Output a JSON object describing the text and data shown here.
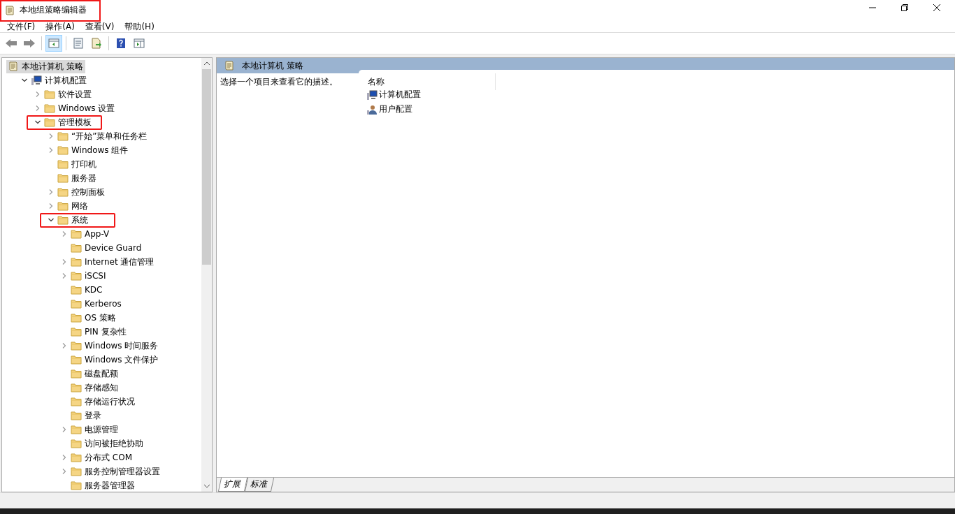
{
  "window": {
    "title": "本地组策略编辑器",
    "highlighted": true
  },
  "menu": [
    "文件(F)",
    "操作(A)",
    "查看(V)",
    "帮助(H)"
  ],
  "toolbar": [
    {
      "kind": "back",
      "selected": false
    },
    {
      "kind": "forward",
      "selected": false
    },
    {
      "kind": "tree",
      "selected": true
    },
    {
      "kind": "properties",
      "selected": false
    },
    {
      "kind": "export",
      "selected": false
    },
    {
      "kind": "help",
      "selected": false
    },
    {
      "kind": "pane",
      "selected": false
    }
  ],
  "tree": [
    {
      "label": "本地计算机 策略",
      "kind": "policy",
      "selected": true,
      "highlighted": false,
      "children": [
        {
          "label": "计算机配置",
          "kind": "computer",
          "selected": false,
          "expanded": true,
          "highlighted": false,
          "children": [
            {
              "label": "软件设置",
              "kind": "folder",
              "selected": false,
              "expanded": false,
              "highlighted": false
            },
            {
              "label": "Windows 设置",
              "kind": "folder",
              "selected": false,
              "expanded": false,
              "highlighted": false
            },
            {
              "label": "管理模板",
              "kind": "folder",
              "selected": false,
              "expanded": true,
              "highlighted": true,
              "children": [
                {
                  "label": "“开始”菜单和任务栏",
                  "kind": "folder",
                  "selected": false,
                  "expanded": false,
                  "highlighted": false
                },
                {
                  "label": "Windows 组件",
                  "kind": "folder",
                  "selected": false,
                  "expanded": false,
                  "highlighted": false
                },
                {
                  "label": "打印机",
                  "kind": "folder",
                  "selected": false,
                  "highlighted": false
                },
                {
                  "label": "服务器",
                  "kind": "folder",
                  "selected": false,
                  "highlighted": false
                },
                {
                  "label": "控制面板",
                  "kind": "folder",
                  "selected": false,
                  "expanded": false,
                  "highlighted": false
                },
                {
                  "label": "网络",
                  "kind": "folder",
                  "selected": false,
                  "expanded": false,
                  "highlighted": false
                },
                {
                  "label": "系统",
                  "kind": "folder",
                  "selected": false,
                  "expanded": true,
                  "highlighted": true,
                  "children": [
                    {
                      "label": "App-V",
                      "kind": "folder",
                      "selected": false,
                      "expanded": false,
                      "highlighted": false
                    },
                    {
                      "label": "Device Guard",
                      "kind": "folder",
                      "selected": false,
                      "highlighted": false
                    },
                    {
                      "label": "Internet 通信管理",
                      "kind": "folder",
                      "selected": false,
                      "expanded": false,
                      "highlighted": false
                    },
                    {
                      "label": "iSCSI",
                      "kind": "folder",
                      "selected": false,
                      "expanded": false,
                      "highlighted": false
                    },
                    {
                      "label": "KDC",
                      "kind": "folder",
                      "selected": false,
                      "highlighted": false
                    },
                    {
                      "label": "Kerberos",
                      "kind": "folder",
                      "selected": false,
                      "highlighted": false
                    },
                    {
                      "label": "OS 策略",
                      "kind": "folder",
                      "selected": false,
                      "highlighted": false
                    },
                    {
                      "label": "PIN 复杂性",
                      "kind": "folder",
                      "selected": false,
                      "highlighted": false
                    },
                    {
                      "label": "Windows 时间服务",
                      "kind": "folder",
                      "selected": false,
                      "expanded": false,
                      "highlighted": false
                    },
                    {
                      "label": "Windows 文件保护",
                      "kind": "folder",
                      "selected": false,
                      "highlighted": false
                    },
                    {
                      "label": "磁盘配额",
                      "kind": "folder",
                      "selected": false,
                      "highlighted": false
                    },
                    {
                      "label": "存储感知",
                      "kind": "folder",
                      "selected": false,
                      "highlighted": false
                    },
                    {
                      "label": "存储运行状况",
                      "kind": "folder",
                      "selected": false,
                      "highlighted": false
                    },
                    {
                      "label": "登录",
                      "kind": "folder",
                      "selected": false,
                      "highlighted": false
                    },
                    {
                      "label": "电源管理",
                      "kind": "folder",
                      "selected": false,
                      "expanded": false,
                      "highlighted": false
                    },
                    {
                      "label": "访问被拒绝协助",
                      "kind": "folder",
                      "selected": false,
                      "highlighted": false
                    },
                    {
                      "label": "分布式 COM",
                      "kind": "folder",
                      "selected": false,
                      "expanded": false,
                      "highlighted": false
                    },
                    {
                      "label": "服务控制管理器设置",
                      "kind": "folder",
                      "selected": false,
                      "expanded": false,
                      "highlighted": false
                    },
                    {
                      "label": "服务器管理器",
                      "kind": "folder",
                      "selected": false,
                      "highlighted": false
                    }
                  ]
                }
              ]
            }
          ]
        }
      ]
    }
  ],
  "detail": {
    "header": "本地计算机 策略",
    "description": "选择一个项目来查看它的描述。",
    "column": "名称",
    "items": [
      {
        "label": "计算机配置",
        "kind": "computer"
      },
      {
        "label": "用户配置",
        "kind": "user"
      }
    ]
  },
  "tabs": [
    {
      "label": "扩展",
      "selected": true
    },
    {
      "label": "标准",
      "selected": false
    }
  ]
}
